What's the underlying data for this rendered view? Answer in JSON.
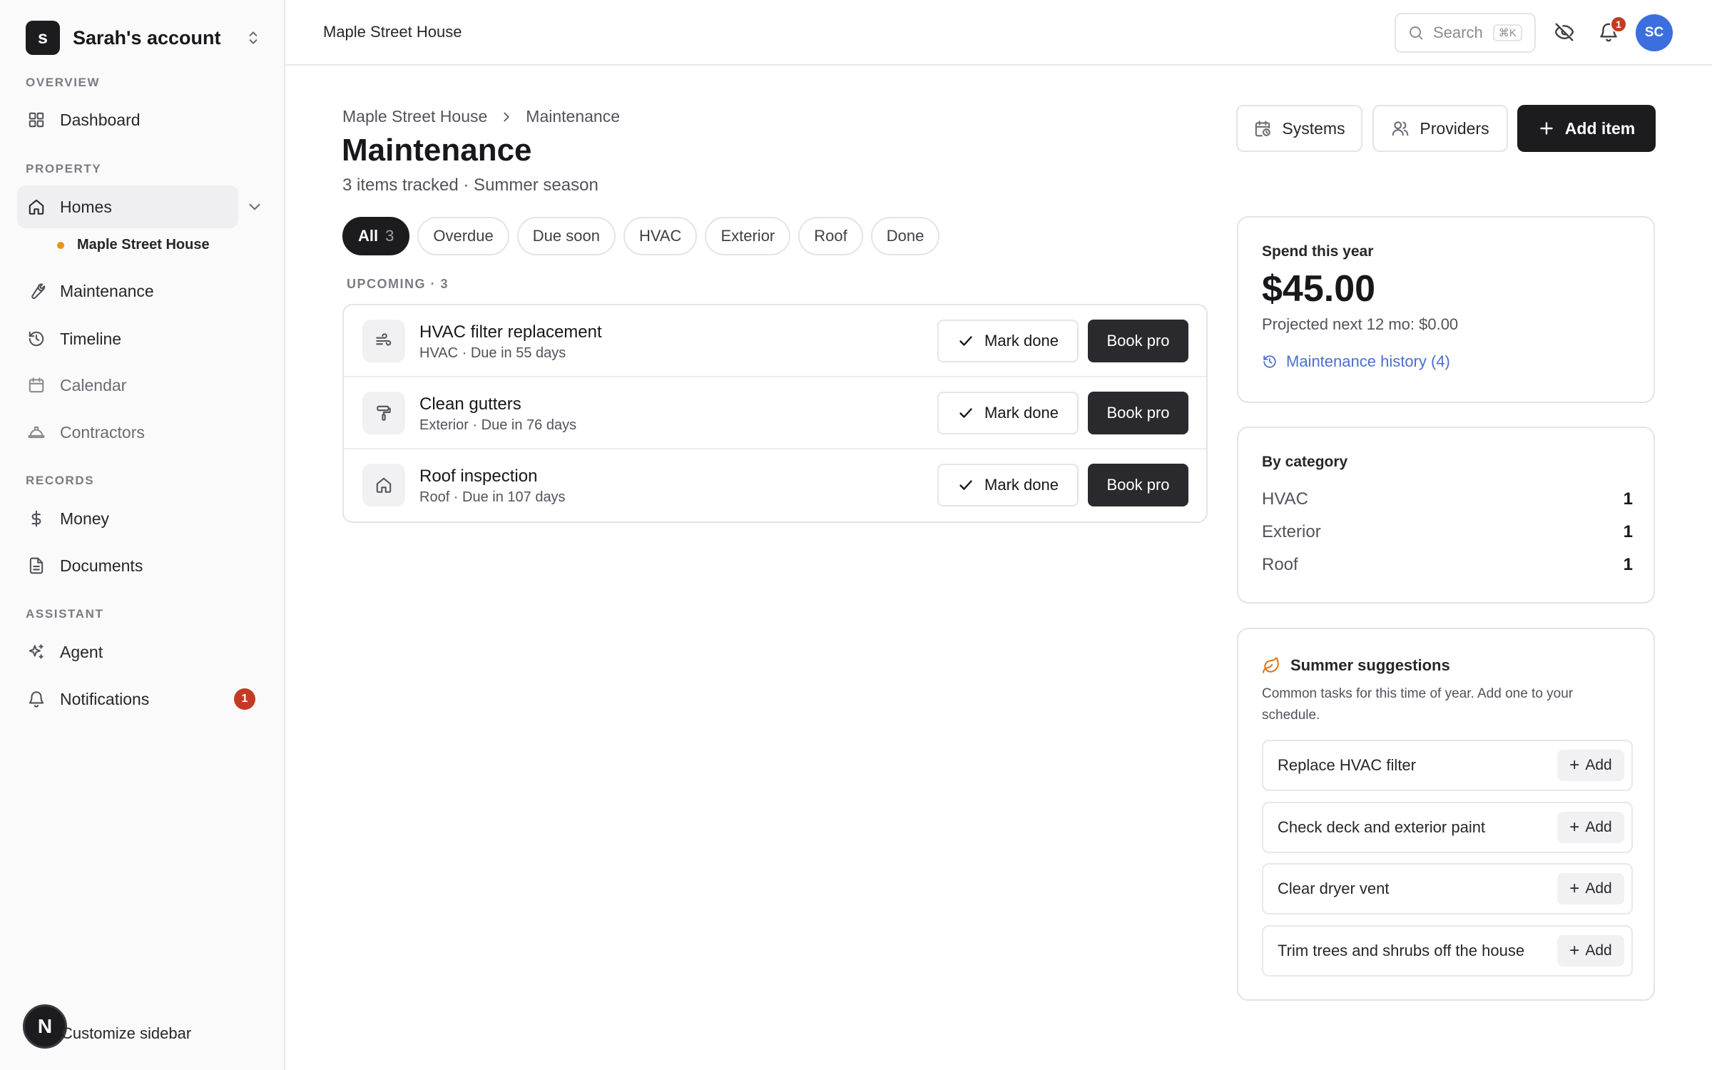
{
  "sidebar": {
    "account": {
      "initial": "s",
      "name": "Sarah's account"
    },
    "sections": {
      "overview": "OVERVIEW",
      "property": "PROPERTY",
      "records": "RECORDS",
      "assistant": "ASSISTANT"
    },
    "items": {
      "dashboard": "Dashboard",
      "homes": "Homes",
      "home_child": "Maple Street House",
      "maintenance": "Maintenance",
      "timeline": "Timeline",
      "calendar": "Calendar",
      "contractors": "Contractors",
      "money": "Money",
      "documents": "Documents",
      "agent": "Agent",
      "notifications": "Notifications"
    },
    "notifications_count": "1",
    "customize": {
      "initial": "N",
      "label": "Customize sidebar"
    }
  },
  "topbar": {
    "title": "Maple Street House",
    "search_placeholder": "Search",
    "search_shortcut": "⌘K",
    "bell_count": "1",
    "user_initials": "SC"
  },
  "header": {
    "breadcrumb": [
      "Maple Street House",
      "Maintenance"
    ],
    "title": "Maintenance",
    "subtitle": "3 items tracked · Summer season",
    "systems_label": "Systems",
    "providers_label": "Providers",
    "add_item_label": "Add item"
  },
  "filters": [
    {
      "label": "All",
      "count": "3",
      "active": true
    },
    {
      "label": "Overdue"
    },
    {
      "label": "Due soon"
    },
    {
      "label": "HVAC"
    },
    {
      "label": "Exterior"
    },
    {
      "label": "Roof"
    },
    {
      "label": "Done"
    }
  ],
  "group_label": "UPCOMING · 3",
  "tasks": [
    {
      "title": "HVAC filter replacement",
      "meta": "HVAC · Due in 55 days",
      "icon": "wind-icon",
      "mark_label": "Mark done",
      "book_label": "Book pro"
    },
    {
      "title": "Clean gutters",
      "meta": "Exterior · Due in 76 days",
      "icon": "paint-roller-icon",
      "mark_label": "Mark done",
      "book_label": "Book pro"
    },
    {
      "title": "Roof inspection",
      "meta": "Roof · Due in 107 days",
      "icon": "house-icon",
      "mark_label": "Mark done",
      "book_label": "Book pro"
    }
  ],
  "spend": {
    "label": "Spend this year",
    "amount": "$45.00",
    "projected": "Projected next 12 mo: $0.00",
    "history_link": "Maintenance history (4)"
  },
  "by_category": {
    "title": "By category",
    "rows": [
      {
        "name": "HVAC",
        "count": "1"
      },
      {
        "name": "Exterior",
        "count": "1"
      },
      {
        "name": "Roof",
        "count": "1"
      }
    ]
  },
  "suggestions": {
    "title": "Summer suggestions",
    "description": "Common tasks for this time of year. Add one to your schedule.",
    "add_label": "Add",
    "items": [
      "Replace HVAC filter",
      "Check deck and exterior paint",
      "Clear dryer vent",
      "Trim trees and shrubs off the house"
    ]
  },
  "colors": {
    "accent_dark": "#1c1c1f",
    "link_blue": "#4a6fd0",
    "badge_red": "#c23b22",
    "avatar_blue": "#3b6fe0",
    "home_dot": "#e8951b",
    "leaf_orange": "#e0751b"
  }
}
